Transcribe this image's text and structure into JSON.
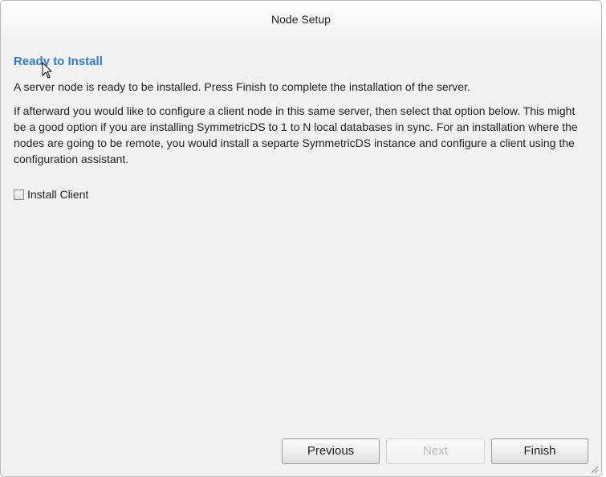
{
  "window": {
    "title": "Node Setup"
  },
  "content": {
    "heading": "Ready to Install",
    "paragraph1": "A server node is ready to be installed. Press Finish to complete the installation of the server.",
    "paragraph2": "If afterward you would like to configure a client node in this same server, then select that option below. This might be a good option if you are installing SymmetricDS to 1 to N local databases in sync. For an installation where the nodes are going to be remote, you would install a separte SymmetricDS instance and configure a client using the configuration assistant.",
    "install_client": {
      "label": "Install Client",
      "checked": false
    }
  },
  "buttons": {
    "previous": "Previous",
    "next": "Next",
    "finish": "Finish"
  },
  "colors": {
    "heading": "#2b7bc9",
    "background": "#f2f2f2",
    "disabled_text": "#b8b8b8"
  },
  "icons": [
    "mouse-cursor-icon",
    "resize-grip-icon"
  ]
}
